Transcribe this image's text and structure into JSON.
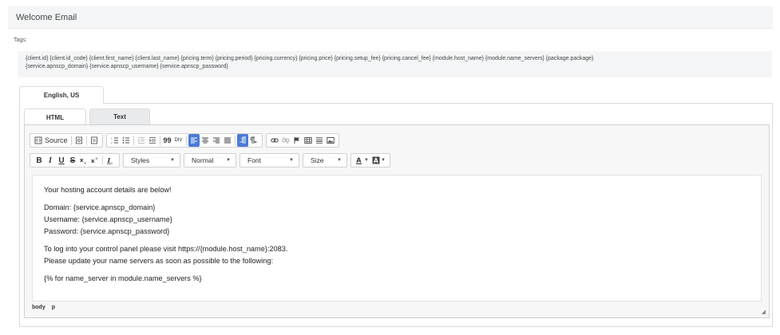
{
  "section": {
    "title": "Welcome Email"
  },
  "tags": {
    "label": "Tags:",
    "line1": "{client.id} {client.id_code} {client.first_name} {client.last_name} {pricing.term} {pricing.period} {pricing.currency} {pricing.price} {pricing.setup_fee} {pricing.cancel_fee} {module.host_name} {module.name_servers} {package.package}",
    "line2": "{service.apnscp_domain} {service.apnscp_username} {service.apnscp_password}"
  },
  "language_tab": {
    "label": "English, US"
  },
  "format_tabs": [
    {
      "label": "HTML"
    },
    {
      "label": "Text"
    }
  ],
  "toolbar": {
    "source_label": "Source",
    "styles_label": "Styles",
    "format_label": "Normal",
    "font_label": "Font",
    "size_label": "Size",
    "bold": "B",
    "italic": "I",
    "underline": "U",
    "strike": "S",
    "blockquote": "99",
    "div": "DIV"
  },
  "editor": {
    "lines": [
      "Your hosting account details are below!",
      "Domain: {service.apnscp_domain}",
      "Username: {service.apnscp_username}",
      "Password: {service.apnscp_password}",
      "To log into your control panel please visit https://{module.host_name}:2083.",
      "Please update your name servers as soon as possible to the following:",
      "{% for name_server in module.name_servers %}"
    ],
    "path": [
      "body",
      "p"
    ]
  },
  "colors": {
    "accent": "#4b7bd6",
    "header_bg": "#f4f5f6"
  }
}
